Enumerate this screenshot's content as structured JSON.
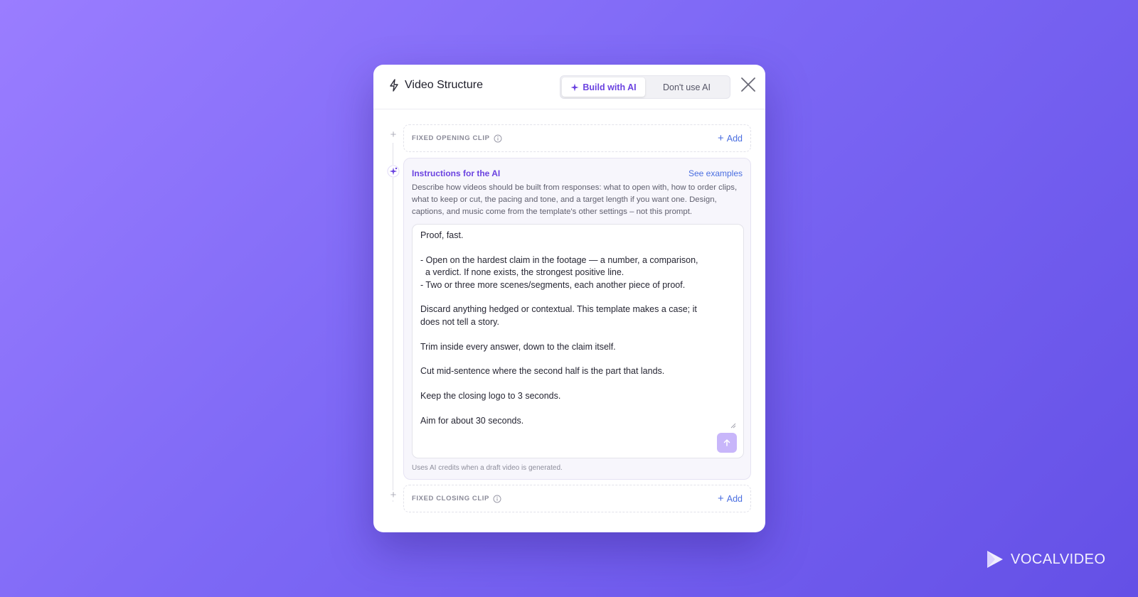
{
  "modal": {
    "title": "Video Structure",
    "title_icon": "bolt-icon",
    "mode_toggle": {
      "build_with_ai": "Build with AI",
      "dont_use_ai": "Don't use AI",
      "selected": "Build with AI"
    },
    "close_icon": "close-icon"
  },
  "opening_clip": {
    "label": "FIXED OPENING CLIP",
    "add_label": "Add"
  },
  "ai_instructions": {
    "title": "Instructions for the AI",
    "see_examples": "See examples",
    "description": "Describe how videos should be built from responses: what to open with, how to order clips, what to keep or cut, the pacing and tone, and a target length if you want one. Design, captions, and music come from the template's other settings – not this prompt.",
    "prompt_value": "Proof, fast.\n\n- Open on the hardest claim in the footage — a number, a comparison,\n  a verdict. If none exists, the strongest positive line.\n- Two or three more scenes/segments, each another piece of proof.\n\nDiscard anything hedged or contextual. This template makes a case; it\ndoes not tell a story.\n\nTrim inside every answer, down to the claim itself.\n\nCut mid-sentence where the second half is the part that lands.\n\nKeep the closing logo to 3 seconds.\n\nAim for about 30 seconds.",
    "credits_note": "Uses AI credits when a draft video is generated."
  },
  "closing_clip": {
    "label": "FIXED CLOSING CLIP",
    "add_label": "Add"
  },
  "brand": {
    "name": "VOCALVIDEO"
  },
  "colors": {
    "accent": "#6b43e0",
    "link": "#4a6ee0",
    "background_start": "#9a7dff",
    "background_end": "#6450e6"
  }
}
